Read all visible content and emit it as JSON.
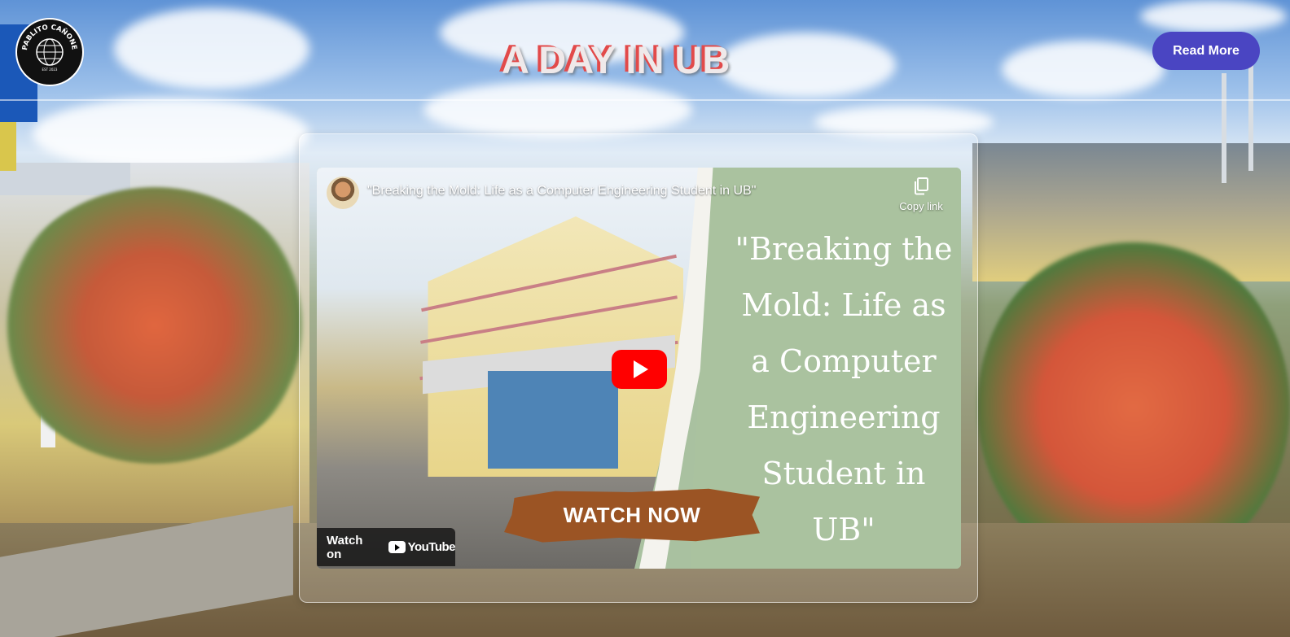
{
  "header": {
    "logo_alt": "PABLITO CAÑONERO JR",
    "title": "A DAY IN UB",
    "read_more_label": "Read More"
  },
  "video": {
    "title": "\"Breaking the Mold: Life as a Computer Engineering Student in UB\"",
    "copy_link_label": "Copy link",
    "overlay_text": "\"Breaking the Mold: Life as a Computer Engineering Student in UB\"",
    "watch_now_label": "WATCH NOW",
    "watch_on_label": "Watch on",
    "youtube_label": "YouTube",
    "play_icon": "play-icon"
  },
  "colors": {
    "accent_button": "#4a45c2",
    "title_shadow": "#e24a4a",
    "watch_now_bg": "#9b5424",
    "youtube_red": "#ff0000",
    "panel_green": "#aac29f"
  }
}
